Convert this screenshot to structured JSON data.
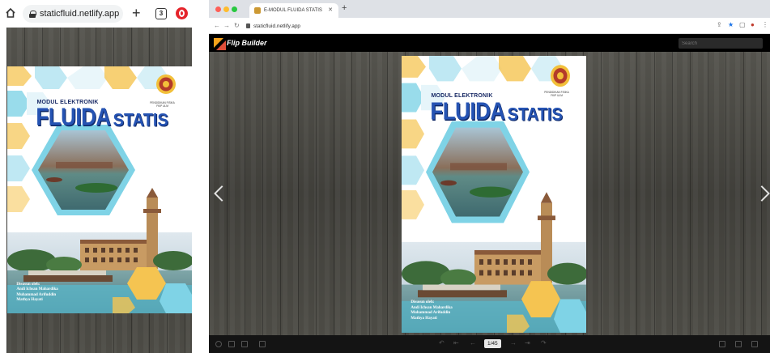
{
  "mobile": {
    "url": "staticfluid.netlify.app",
    "tab_count": "3"
  },
  "desktop": {
    "tab_title": "E-MODUL FLUIDA STATIS",
    "url": "staticfluid.netlify.app",
    "app_name": "Flip Builder",
    "search_placeholder": "Search",
    "page_indicator": "1/45"
  },
  "cover": {
    "subtitle": "MODUL ELEKTRONIK",
    "title_main": "FLUIDA",
    "title_second": "STATIS",
    "university": "PENDIDIKAN FISIKA\nFKIP ULM",
    "authors_heading": "Disusun oleh:",
    "authors": [
      "Andi Ichsan Mahardika",
      "Muhammad Arifuddin",
      "Mathya Hayati"
    ]
  },
  "colors": {
    "hex_blue": "#7fd3e6",
    "hex_yellow": "#f5c451",
    "title_blue": "#2553b3",
    "wood_dark": "#4a4a45"
  }
}
